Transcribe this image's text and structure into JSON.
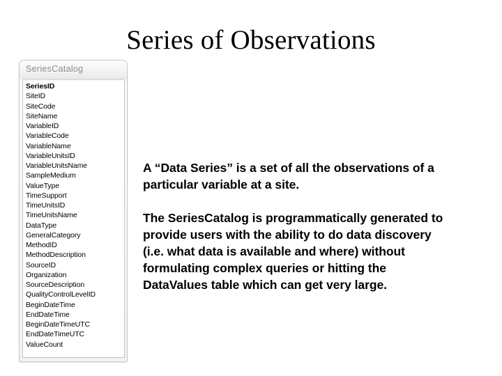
{
  "slide": {
    "title": "Series of Observations",
    "background_color": "#ffffff"
  },
  "entity_box": {
    "title": "SeriesCatalog",
    "title_color": "#8c8c8c",
    "border_color": "#c9c9c9",
    "panel_background": "#ffffff",
    "fields": [
      {
        "name": "SeriesID",
        "is_primary_key": true
      },
      {
        "name": "SiteID",
        "is_primary_key": false
      },
      {
        "name": "SiteCode",
        "is_primary_key": false
      },
      {
        "name": "SiteName",
        "is_primary_key": false
      },
      {
        "name": "VariableID",
        "is_primary_key": false
      },
      {
        "name": "VariableCode",
        "is_primary_key": false
      },
      {
        "name": "VariableName",
        "is_primary_key": false
      },
      {
        "name": "VariableUnitsID",
        "is_primary_key": false
      },
      {
        "name": "VariableUnitsName",
        "is_primary_key": false
      },
      {
        "name": "SampleMedium",
        "is_primary_key": false
      },
      {
        "name": "ValueType",
        "is_primary_key": false
      },
      {
        "name": "TimeSupport",
        "is_primary_key": false
      },
      {
        "name": "TimeUnitsID",
        "is_primary_key": false
      },
      {
        "name": "TimeUnitsName",
        "is_primary_key": false
      },
      {
        "name": "DataType",
        "is_primary_key": false
      },
      {
        "name": "GeneralCategory",
        "is_primary_key": false
      },
      {
        "name": "MethodID",
        "is_primary_key": false
      },
      {
        "name": "MethodDescription",
        "is_primary_key": false
      },
      {
        "name": "SourceID",
        "is_primary_key": false
      },
      {
        "name": "Organization",
        "is_primary_key": false
      },
      {
        "name": "SourceDescription",
        "is_primary_key": false
      },
      {
        "name": "QualityControlLevelID",
        "is_primary_key": false
      },
      {
        "name": "BeginDateTime",
        "is_primary_key": false
      },
      {
        "name": "EndDateTime",
        "is_primary_key": false
      },
      {
        "name": "BeginDateTimeUTC",
        "is_primary_key": false
      },
      {
        "name": "EndDateTimeUTC",
        "is_primary_key": false
      },
      {
        "name": "ValueCount",
        "is_primary_key": false
      }
    ]
  },
  "body": {
    "paragraph_1": "A “Data Series” is a set of all the observations of a particular variable at a site.",
    "paragraph_2": "The SeriesCatalog is programmatically generated to provide users with the ability to do data discovery (i.e. what data is available and where) without formulating complex queries or hitting the DataValues table which can get very large."
  }
}
